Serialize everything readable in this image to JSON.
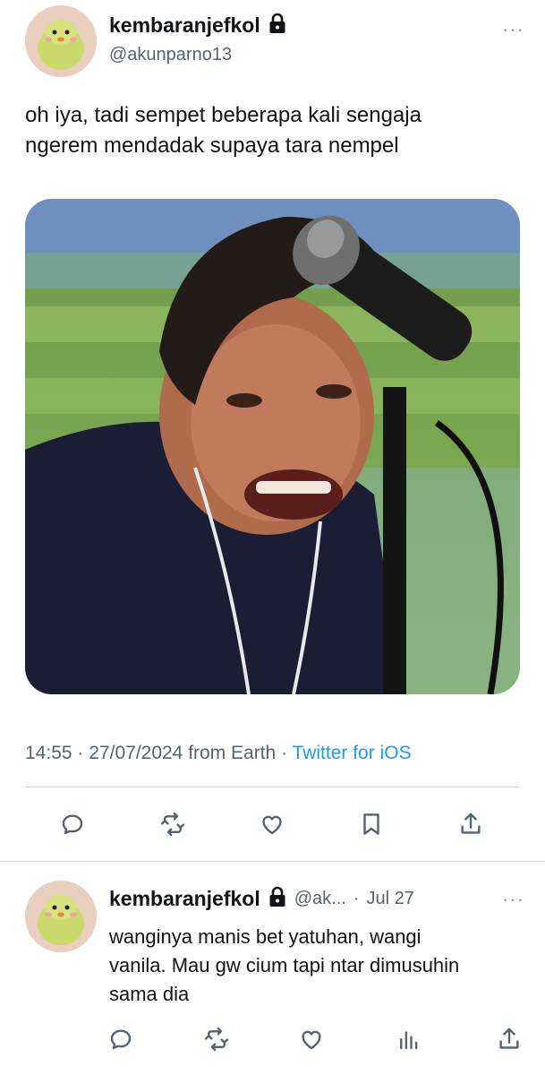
{
  "tweet": {
    "display_name": "kembaranjefkol",
    "handle": "@akunparno13",
    "text_line1": "oh iya, tadi sempet beberapa kali sengaja",
    "text_line2": "ngerem mendadak supaya tara nempel",
    "time": "14:55",
    "date": "27/07/2024",
    "from_location": "from Earth",
    "separator": "·",
    "source": "Twitter for iOS",
    "more_label": "···"
  },
  "reply": {
    "display_name": "kembaranjefkol",
    "handle": "@ak...",
    "separator": "·",
    "date": "Jul 27",
    "text_line1": "wanginya manis bet yatuhan, wangi",
    "text_line2": "vanila. Mau gw cium tapi ntar dimusuhin",
    "text_line3": "sama dia",
    "more_label": "···"
  },
  "icons": {
    "tweet_actions": [
      "reply-icon",
      "retweet-icon",
      "like-icon",
      "bookmark-icon",
      "share-icon"
    ],
    "reply_actions": [
      "reply-icon",
      "retweet-icon",
      "like-icon",
      "views-icon",
      "share-icon"
    ]
  },
  "colors": {
    "text": "#0f1419",
    "secondary": "#536471",
    "link": "#1d9bf0",
    "divider": "#cfd9de"
  }
}
